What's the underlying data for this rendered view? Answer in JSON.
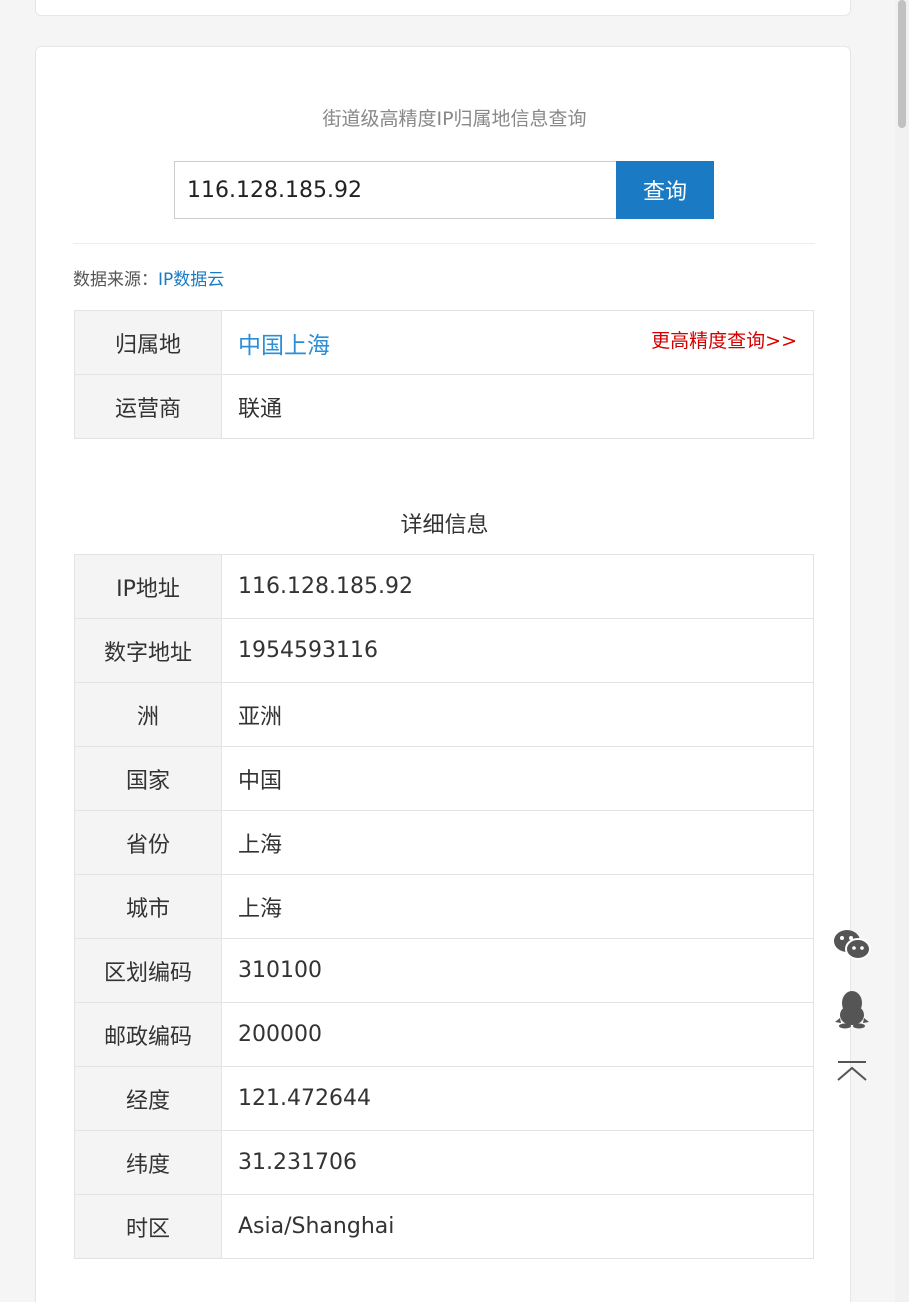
{
  "page": {
    "title": "街道级高精度IP归属地信息查询"
  },
  "search": {
    "value": "116.128.185.92",
    "button_label": "查询"
  },
  "source": {
    "label": "数据来源：",
    "link": "IP数据云"
  },
  "summary": {
    "location_label": "归属地",
    "location_value": "中国上海",
    "precise_link": "更高精度查询>>",
    "isp_label": "运营商",
    "isp_value": "联通"
  },
  "detail": {
    "title": "详细信息",
    "rows": [
      {
        "label": "IP地址",
        "value": "116.128.185.92"
      },
      {
        "label": "数字地址",
        "value": "1954593116"
      },
      {
        "label": "洲",
        "value": "亚洲"
      },
      {
        "label": "国家",
        "value": "中国"
      },
      {
        "label": "省份",
        "value": "上海"
      },
      {
        "label": "城市",
        "value": "上海"
      },
      {
        "label": "区划编码",
        "value": "310100"
      },
      {
        "label": "邮政编码",
        "value": "200000"
      },
      {
        "label": "经度",
        "value": "121.472644"
      },
      {
        "label": "纬度",
        "value": "31.231706"
      },
      {
        "label": "时区",
        "value": "Asia/Shanghai"
      }
    ]
  },
  "float_bar": {
    "icons": [
      "wechat-icon",
      "qq-icon",
      "back-to-top-icon"
    ]
  },
  "colors": {
    "accent": "#1a7bc4",
    "location_link": "#2b8fd8",
    "precise_link": "#d40000"
  }
}
